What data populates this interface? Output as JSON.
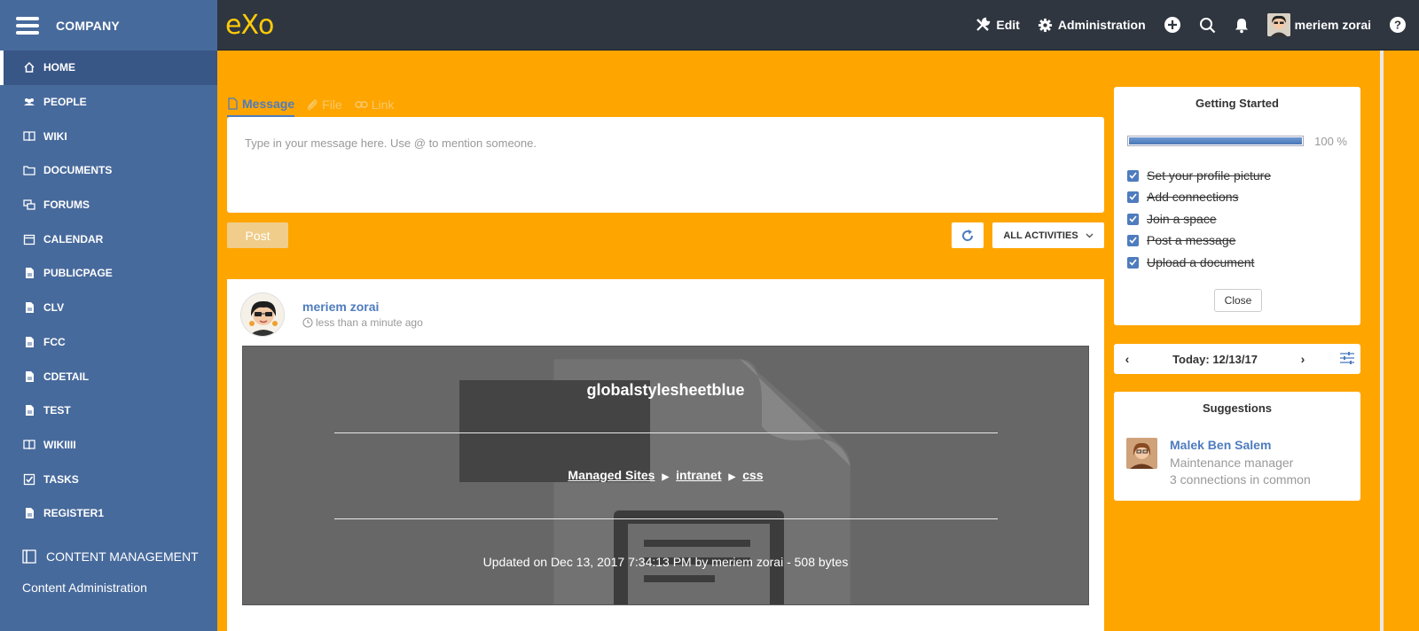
{
  "sidebar": {
    "company": "COMPANY",
    "items": [
      {
        "label": "HOME",
        "icon": "home-icon"
      },
      {
        "label": "PEOPLE",
        "icon": "people-icon"
      },
      {
        "label": "WIKI",
        "icon": "book-icon"
      },
      {
        "label": "DOCUMENTS",
        "icon": "folder-icon"
      },
      {
        "label": "FORUMS",
        "icon": "forums-icon"
      },
      {
        "label": "CALENDAR",
        "icon": "calendar-icon"
      },
      {
        "label": "PUBLICPAGE",
        "icon": "page-icon"
      },
      {
        "label": "CLV",
        "icon": "page-icon"
      },
      {
        "label": "FCC",
        "icon": "page-icon"
      },
      {
        "label": "CDETAIL",
        "icon": "page-icon"
      },
      {
        "label": "TEST",
        "icon": "page-icon"
      },
      {
        "label": "WIKIIII",
        "icon": "book-icon"
      },
      {
        "label": "TASKS",
        "icon": "tasks-icon"
      },
      {
        "label": "REGISTER1",
        "icon": "page-icon"
      }
    ],
    "section": "CONTENT MANAGEMENT",
    "section_link": "Content Administration"
  },
  "topbar": {
    "logo": "eXo",
    "edit": "Edit",
    "administration": "Administration",
    "user": "meriem zorai"
  },
  "composer": {
    "tabs": [
      "Message",
      "File",
      "Link"
    ],
    "placeholder": "Type in your message here. Use @ to mention someone.",
    "post": "Post",
    "filter": "ALL ACTIVITIES"
  },
  "activity": {
    "user": "meriem zorai",
    "time": "less than a minute ago",
    "file_title": "globalstylesheetblue",
    "path": [
      "Managed Sites",
      "intranet",
      "css"
    ],
    "meta": "Updated on Dec 13, 2017 7:34:13 PM by meriem zorai - 508 bytes"
  },
  "getting_started": {
    "title": "Getting Started",
    "progress": 100,
    "percent_label": "100 %",
    "tasks": [
      "Set your profile picture",
      "Add connections",
      "Join a space",
      "Post a message",
      "Upload a document"
    ],
    "close": "Close"
  },
  "calendar": {
    "today": "Today: 12/13/17"
  },
  "suggestions": {
    "title": "Suggestions",
    "name": "Malek Ben Salem",
    "role": "Maintenance manager",
    "common": "3 connections in common"
  },
  "colors": {
    "accent": "#4e7cbe",
    "sidebar": "#476a9c",
    "background": "#ffa500",
    "topbar": "#2f3640"
  }
}
